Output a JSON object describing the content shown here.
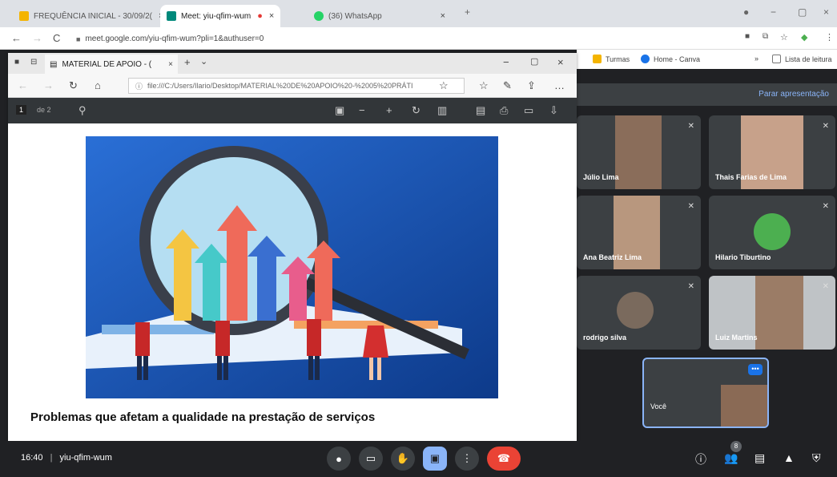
{
  "chrome": {
    "tabs": [
      {
        "label": "FREQUÊNCIA INICIAL - 30/09/2(",
        "icon": "sheets-icon",
        "color": "#f4b400"
      },
      {
        "label": "Meet: yiu-qfim-wum",
        "icon": "meet-icon",
        "color": "#00897b"
      },
      {
        "label": "(36) WhatsApp",
        "icon": "whatsapp-icon",
        "color": "#25d366"
      }
    ],
    "address": "meet.google.com/yiu-qfim-wum?pli=1&authuser=0"
  },
  "bookmarks": [
    {
      "label": "Turmas",
      "icon": "classroom-icon"
    },
    {
      "label": "Home - Canva",
      "icon": "canva-icon"
    },
    {
      "label": "Lista de leitura",
      "icon": "reading-list-icon"
    }
  ],
  "edge": {
    "tab_label": "MATERIAL DE APOIO - (",
    "url": "file:///C:/Users/Ilario/Desktop/MATERIAL%20DE%20APOIO%20-%2005%20PRÁTI",
    "pdf_page": "1",
    "pdf_total": "de 2",
    "caption": "Problemas que afetam a qualidade na prestação de serviços"
  },
  "meet": {
    "present_stop": "Parar apresentação",
    "participants": [
      {
        "name": "Júlio Lima"
      },
      {
        "name": "Thais Farias de Lima"
      },
      {
        "name": "Ana Beatriz Lima"
      },
      {
        "name": "Hilario Tiburtino"
      },
      {
        "name": "rodrigo silva"
      },
      {
        "name": "Luiz Martins"
      }
    ],
    "self_name": "Você",
    "time": "16:40",
    "meeting_code": "yiu-qfim-wum",
    "separator": "|",
    "participant_count": "8"
  }
}
